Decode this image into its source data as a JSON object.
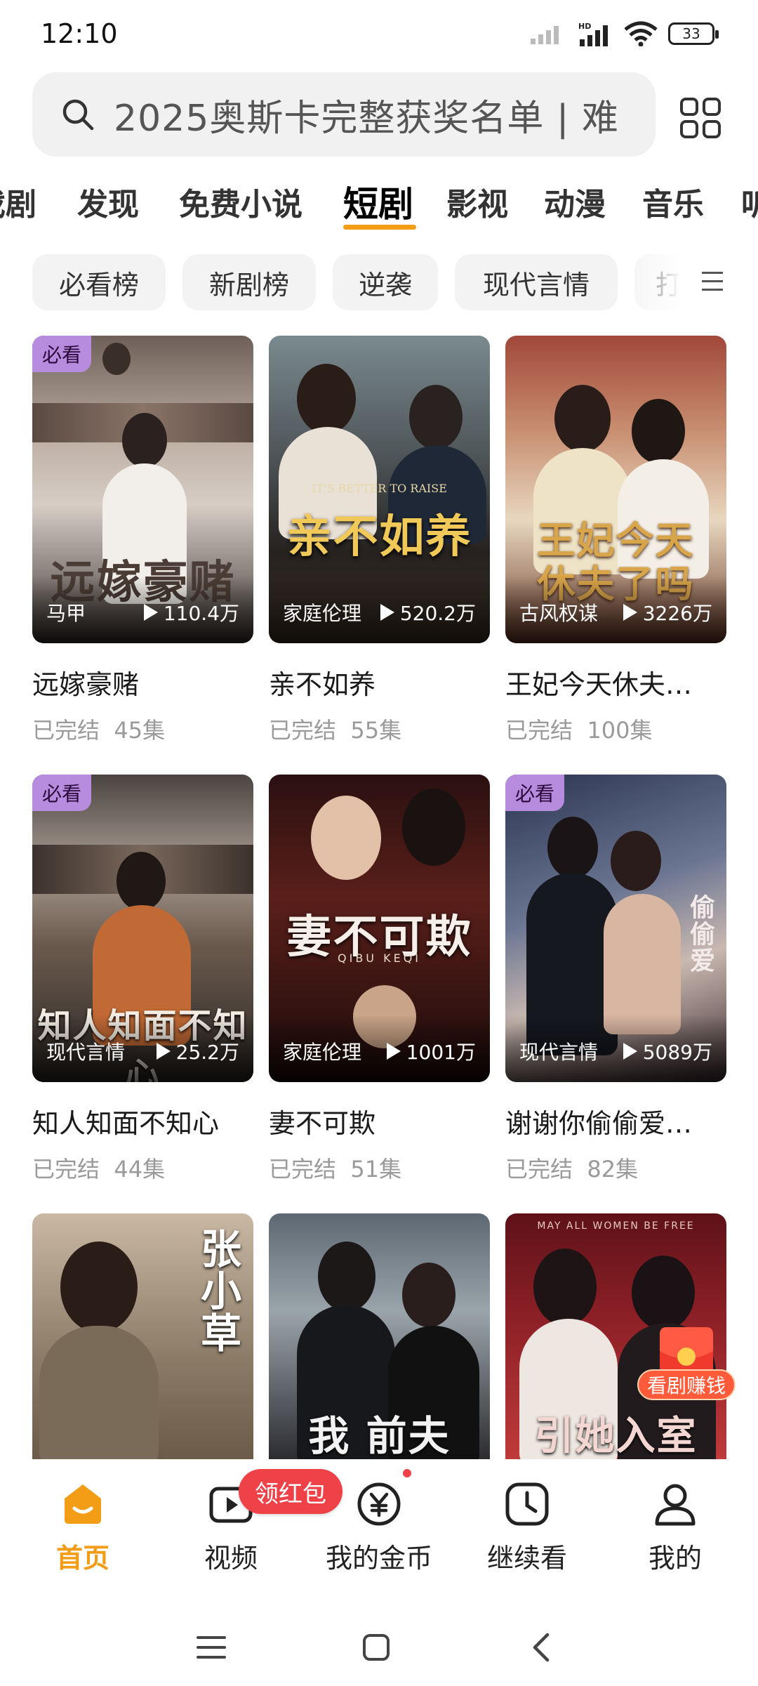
{
  "status_bar": {
    "time": "12:10",
    "battery": "33"
  },
  "search": {
    "text": "2025奥斯卡完整获奖名单 | 难"
  },
  "tabs": [
    {
      "label": "戏剧"
    },
    {
      "label": "发现"
    },
    {
      "label": "免费小说"
    },
    {
      "label": "短剧",
      "active": true
    },
    {
      "label": "影视"
    },
    {
      "label": "动漫"
    },
    {
      "label": "音乐"
    },
    {
      "label": "听"
    }
  ],
  "chips": [
    {
      "label": "必看榜"
    },
    {
      "label": "新剧榜"
    },
    {
      "label": "逆袭"
    },
    {
      "label": "现代言情"
    },
    {
      "label": "打脸"
    }
  ],
  "cards": [
    {
      "badge": "必看",
      "poster_text": "远嫁豪赌",
      "genre": "马甲",
      "plays": "110.4万",
      "title": "远嫁豪赌",
      "status": "已完结",
      "episodes": "45集"
    },
    {
      "badge": "",
      "poster_text": "亲不如养",
      "poster_subtext": "IT'S BETTER TO RAISE",
      "genre": "家庭伦理",
      "plays": "520.2万",
      "title": "亲不如养",
      "status": "已完结",
      "episodes": "55集"
    },
    {
      "badge": "",
      "poster_text": "王妃今天休夫了吗",
      "genre": "古风权谋",
      "plays": "3226万",
      "title": "王妃今天休夫…",
      "status": "已完结",
      "episodes": "100集"
    },
    {
      "badge": "必看",
      "poster_text": "知人知面不知心",
      "genre": "现代言情",
      "plays": "25.2万",
      "title": "知人知面不知心",
      "status": "已完结",
      "episodes": "44集"
    },
    {
      "badge": "",
      "poster_text": "妻不可欺",
      "poster_subtext": "QIBU  KEQI",
      "genre": "家庭伦理",
      "plays": "1001万",
      "title": "妻不可欺",
      "status": "已完结",
      "episodes": "51集"
    },
    {
      "badge": "必看",
      "poster_text": "偷偷爱",
      "genre": "现代言情",
      "plays": "5089万",
      "title": "谢谢你偷偷爱…",
      "status": "已完结",
      "episodes": "82集"
    },
    {
      "poster_text": "张小草"
    },
    {
      "poster_text": "我 前夫"
    },
    {
      "poster_text": "引她入室",
      "poster_subtext": "MAY ALL WOMEN BE FREE"
    }
  ],
  "float_reward": {
    "label": "看剧赚钱"
  },
  "bottom_nav": {
    "promo_pill": "领红包",
    "items": [
      {
        "label": "首页",
        "icon": "home-icon",
        "active": true
      },
      {
        "label": "视频",
        "icon": "video-icon"
      },
      {
        "label": "我的金币",
        "icon": "coin-icon"
      },
      {
        "label": "继续看",
        "icon": "clock-icon"
      },
      {
        "label": "我的",
        "icon": "user-icon"
      }
    ]
  },
  "colors": {
    "accent": "#f39d17",
    "red": "#ef4148",
    "badge": "#b78bde"
  }
}
